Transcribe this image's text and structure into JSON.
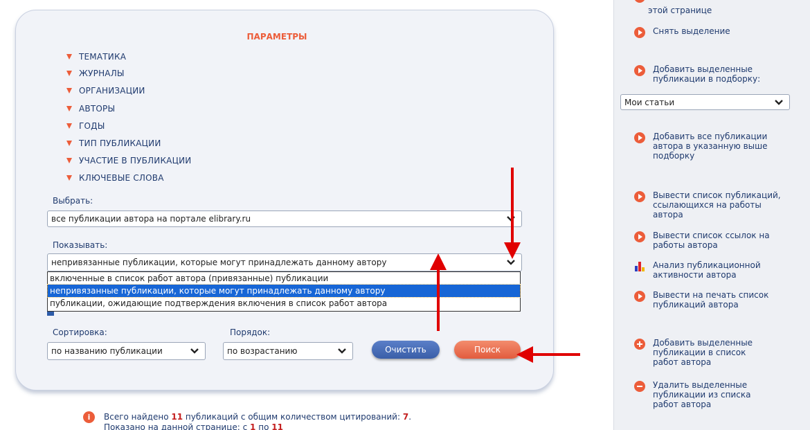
{
  "params": {
    "title": "ПАРАМЕТРЫ",
    "categories": [
      {
        "label": "ТЕМАТИКА"
      },
      {
        "label": "ЖУРНАЛЫ"
      },
      {
        "label": "ОРГАНИЗАЦИИ"
      },
      {
        "label": "АВТОРЫ"
      },
      {
        "label": "ГОДЫ"
      },
      {
        "label": "ТИП ПУБЛИКАЦИИ"
      },
      {
        "label": "УЧАСТИЕ В ПУБЛИКАЦИИ"
      },
      {
        "label": "КЛЮЧЕВЫЕ СЛОВА"
      }
    ]
  },
  "select_filter": {
    "label": "Выбрать:",
    "value": "все публикации автора на портале elibrary.ru"
  },
  "show_filter": {
    "label": "Показывать:",
    "value": "непривязанные публикации, которые могут принадлежать данному автору",
    "options": [
      "включенные в список работ автора (привязанные) публикации",
      "непривязанные публикации, которые могут принадлежать данному автору",
      "публикации, ожидающие подтверждения включения в список работ автора"
    ]
  },
  "sort": {
    "label": "Сортировка:",
    "value": "по названию публикации"
  },
  "order": {
    "label": "Порядок:",
    "value": "по возрастанию"
  },
  "buttons": {
    "clear": "Очистить",
    "search": "Поиск"
  },
  "summary": {
    "line1_prefix": "Всего найдено ",
    "found_count": "11",
    "line1_mid": " публикаций с общим количеством цитирований: ",
    "citations": "7",
    "line1_suffix": ".",
    "line2_prefix": "Показано на данной странице: с ",
    "from": "1",
    "line2_mid": " по ",
    "to": "11"
  },
  "sidebar": {
    "top_partial": "этой странице",
    "deselect": "Снять выделение",
    "add_selected_to_collection": "Добавить выделенные публикации в подборку:",
    "collection_value": "Мои статьи",
    "add_all_to_collection": "Добавить все публикации автора в указанную выше подборку",
    "citing_list": "Вывести список публикаций, ссылающихся на работы автора",
    "references_list": "Вывести список ссылок на работы автора",
    "analysis": "Анализ публикационной активности автора",
    "print_list": "Вывести на печать список публикаций автора",
    "add_to_author_list": "Добавить выделенные публикации в список работ автора",
    "remove_from_author_list": "Удалить выделенные публикации из списка работ автора"
  },
  "colors": {
    "accent": "#ec5d3a",
    "text": "#1f3a6e",
    "selection": "#1766d6",
    "clear_button": "#3a5ea8",
    "search_button": "#e25c3e",
    "annotation": "#e00000"
  }
}
